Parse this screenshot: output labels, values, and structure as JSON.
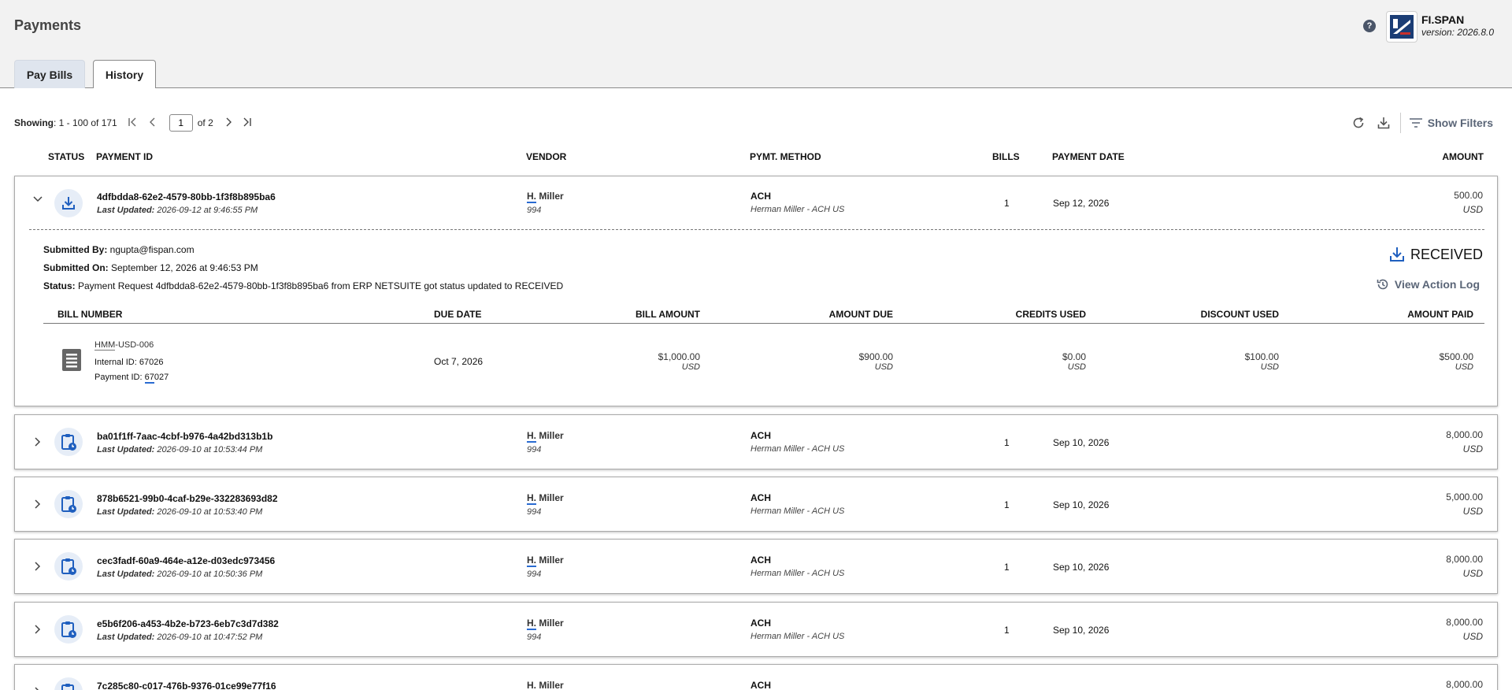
{
  "header": {
    "title": "Payments",
    "help_glyph": "?",
    "brand": {
      "name": "FI.SPAN",
      "version": "version: 2026.8.0"
    }
  },
  "tabs": [
    {
      "label": "Pay Bills",
      "active": false
    },
    {
      "label": "History",
      "active": true
    }
  ],
  "pager": {
    "showing_label": "Showing",
    "range": ": 1 - 100 of 171",
    "page": "1",
    "of": "of 2"
  },
  "toolbar": {
    "filters_label": "Show Filters"
  },
  "columns": {
    "status": "STATUS",
    "payment_id": "PAYMENT ID",
    "vendor": "VENDOR",
    "method": "PYMT. METHOD",
    "bills": "BILLS",
    "date": "PAYMENT DATE",
    "amount": "AMOUNT"
  },
  "payments": [
    {
      "id": "4dfbdda8-62e2-4579-80bb-1f3f8b895ba6",
      "updated_label": "Last Updated:",
      "updated": " 2026-09-12 at 9:46:55 PM",
      "vendor_abbr": "H.",
      "vendor_rest": " Miller",
      "vendor_code": "994",
      "method": "ACH",
      "method_detail": "Herman Miller - ACH US",
      "bills": "1",
      "date": "Sep 12, 2026",
      "amount": "500.00",
      "currency": "USD",
      "status_icon": "download-icon",
      "expanded": true
    },
    {
      "id": "ba01f1ff-7aac-4cbf-b976-4a42bd313b1b",
      "updated_label": "Last Updated:",
      "updated": " 2026-09-10 at 10:53:44 PM",
      "vendor_abbr": "H.",
      "vendor_rest": " Miller",
      "vendor_code": "994",
      "method": "ACH",
      "method_detail": "Herman Miller - ACH US",
      "bills": "1",
      "date": "Sep 10, 2026",
      "amount": "8,000.00",
      "currency": "USD",
      "status_icon": "clipboard-clock-icon"
    },
    {
      "id": "878b6521-99b0-4caf-b29e-332283693d82",
      "updated_label": "Last Updated:",
      "updated": " 2026-09-10 at 10:53:40 PM",
      "vendor_abbr": "H.",
      "vendor_rest": " Miller",
      "vendor_code": "994",
      "method": "ACH",
      "method_detail": "Herman Miller - ACH US",
      "bills": "1",
      "date": "Sep 10, 2026",
      "amount": "5,000.00",
      "currency": "USD",
      "status_icon": "clipboard-clock-icon"
    },
    {
      "id": "cec3fadf-60a9-464e-a12e-d03edc973456",
      "updated_label": "Last Updated:",
      "updated": " 2026-09-10 at 10:50:36 PM",
      "vendor_abbr": "H.",
      "vendor_rest": " Miller",
      "vendor_code": "994",
      "method": "ACH",
      "method_detail": "Herman Miller - ACH US",
      "bills": "1",
      "date": "Sep 10, 2026",
      "amount": "8,000.00",
      "currency": "USD",
      "status_icon": "clipboard-clock-icon"
    },
    {
      "id": "e5b6f206-a453-4b2e-b723-6eb7c3d7d382",
      "updated_label": "Last Updated:",
      "updated": " 2026-09-10 at 10:47:52 PM",
      "vendor_abbr": "H.",
      "vendor_rest": " Miller",
      "vendor_code": "994",
      "method": "ACH",
      "method_detail": "Herman Miller - ACH US",
      "bills": "1",
      "date": "Sep 10, 2026",
      "amount": "8,000.00",
      "currency": "USD",
      "status_icon": "clipboard-clock-icon"
    },
    {
      "id": "7c285c80-c017-476b-9376-01ce99e77f16",
      "vendor_abbr": "H.",
      "vendor_rest": " Miller",
      "method": "ACH",
      "amount": "8,000.00",
      "status_icon": "clipboard-clock-icon"
    }
  ],
  "detail": {
    "submitted_by_label": "Submitted By:",
    "submitted_by": " ngupta@fispan.com",
    "submitted_on_label": "Submitted On:",
    "submitted_on": " September 12, 2026 at 9:46:53 PM",
    "status_label": "Status:",
    "status_text": " Payment Request 4dfbdda8-62e2-4579-80bb-1f3f8b895ba6 from ERP NETSUITE got status updated to RECEIVED",
    "status_badge": "RECEIVED",
    "action_log_label": "View Action Log",
    "bill_columns": {
      "number": "BILL NUMBER",
      "due": "DUE DATE",
      "amount": "BILL AMOUNT",
      "due_amt": "AMOUNT DUE",
      "credits": "CREDITS USED",
      "discount": "DISCOUNT USED",
      "paid": "AMOUNT PAID"
    },
    "bill": {
      "number_abbr": "HMM",
      "number_rest": "-USD-006",
      "internal_label": "Internal ID: 67026",
      "payment_label": "Payment ID: ",
      "payment_id_ul": "67",
      "payment_id_rest": "027",
      "due": "Oct 7, 2026",
      "amount": "$1,000.00",
      "amount_due": "$900.00",
      "credits": "$0.00",
      "discount": "$100.00",
      "paid": "$500.00",
      "currency": "USD"
    }
  },
  "colors": {
    "accent": "#2a6bd1",
    "icon_blue": "#1f5fbf",
    "muted_link": "#5a6577"
  }
}
